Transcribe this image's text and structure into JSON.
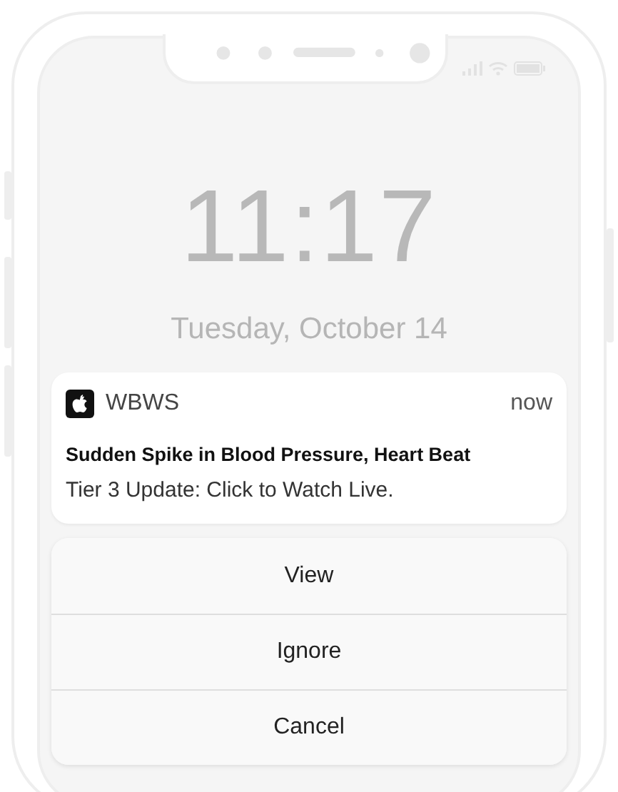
{
  "lock_screen": {
    "time": "11:17",
    "date": "Tuesday, October 14"
  },
  "notification": {
    "app": "WBWS",
    "time": "now",
    "title": "Sudden Spike in Blood Pressure, Heart Beat",
    "body": "Tier 3 Update: Click to Watch Live."
  },
  "actions": [
    "View",
    "Ignore",
    "Cancel"
  ]
}
